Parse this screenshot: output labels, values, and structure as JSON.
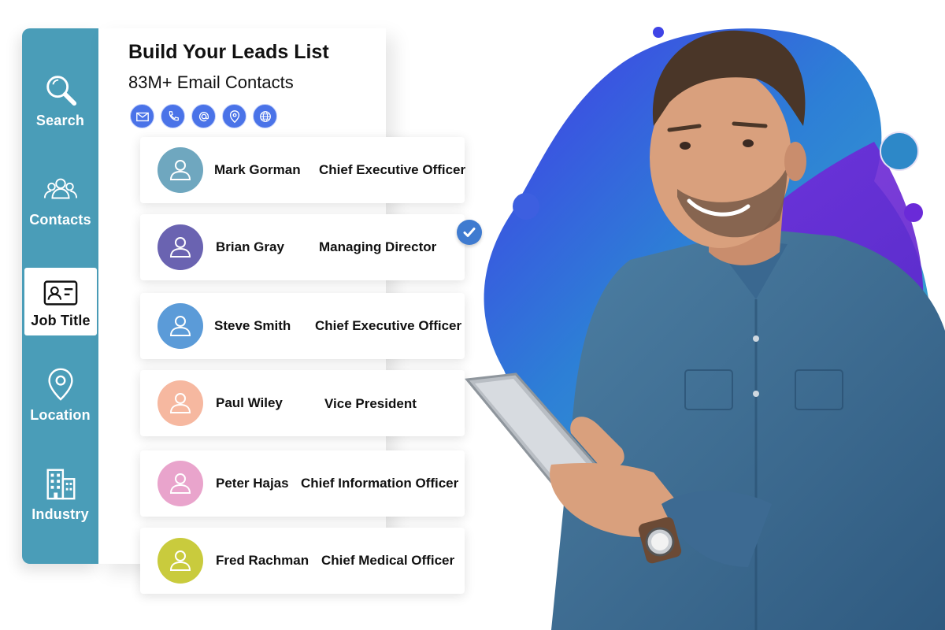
{
  "sidebar": {
    "items": [
      {
        "label": "Search",
        "icon": "search-icon"
      },
      {
        "label": "Contacts",
        "icon": "contacts-icon"
      },
      {
        "label": "Job Title",
        "icon": "id-card-icon",
        "active": true
      },
      {
        "label": "Location",
        "icon": "location-pin-icon"
      },
      {
        "label": "Industry",
        "icon": "building-icon"
      }
    ],
    "color": "#4a9db8"
  },
  "panel": {
    "title": "Build Your Leads List",
    "subtitle": "83M+ Email Contacts",
    "channels": [
      "envelope-icon",
      "phone-icon",
      "at-icon",
      "location-pin-icon",
      "globe-icon"
    ]
  },
  "contacts": [
    {
      "name": "Mark Gorman",
      "title": "Chief Executive Officer",
      "avatar_color": "#6fa7bf"
    },
    {
      "name": "Brian Gray",
      "title": "Managing Director",
      "avatar_color": "#6a63b1",
      "selected": true
    },
    {
      "name": "Steve Smith",
      "title": "Chief Executive Officer",
      "avatar_color": "#5b9bd8"
    },
    {
      "name": "Paul Wiley",
      "title": "Vice President",
      "avatar_color": "#f6b8a0"
    },
    {
      "name": "Peter Hajas",
      "title": "Chief Information Officer",
      "avatar_color": "#e9a4cc"
    },
    {
      "name": "Fred Rachman",
      "title": "Chief Medical Officer",
      "avatar_color": "#c9cb3d"
    }
  ],
  "accent": "#4a73e8",
  "check_color": "#3f7bd0",
  "hero": {
    "description_icon": "man-with-tablet-photo"
  }
}
